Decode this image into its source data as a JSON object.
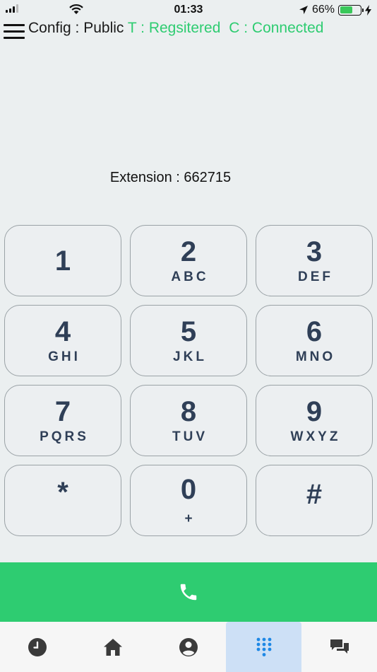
{
  "status_bar": {
    "time": "01:33",
    "battery_percent": "66%",
    "battery_level": 0.66,
    "icons": [
      "signal-icon",
      "wifi-icon",
      "location-arrow-icon",
      "battery-icon",
      "charging-bolt-icon"
    ]
  },
  "header": {
    "config_label": "Config : Public",
    "transport_status": "T : Regsitered",
    "connection_status": "C : Connected",
    "status_color": "#2ecc71"
  },
  "extension_label": "Extension : 662715",
  "keypad": [
    {
      "digit": "1",
      "letters": ""
    },
    {
      "digit": "2",
      "letters": "ABC"
    },
    {
      "digit": "3",
      "letters": "DEF"
    },
    {
      "digit": "4",
      "letters": "GHI"
    },
    {
      "digit": "5",
      "letters": "JKL"
    },
    {
      "digit": "6",
      "letters": "MNO"
    },
    {
      "digit": "7",
      "letters": "PQRS"
    },
    {
      "digit": "8",
      "letters": "TUV"
    },
    {
      "digit": "9",
      "letters": "WXYZ"
    },
    {
      "digit": "*",
      "letters": ""
    },
    {
      "digit": "0",
      "letters": "+"
    },
    {
      "digit": "#",
      "letters": ""
    }
  ],
  "colors": {
    "accent_green": "#2ecc71",
    "key_text": "#2f3f57",
    "active_tab_bg": "#cde0f6",
    "active_tab_icon": "#1e88e5"
  },
  "tabs": [
    {
      "icon": "clock-icon",
      "active": false
    },
    {
      "icon": "home-icon",
      "active": false
    },
    {
      "icon": "user-icon",
      "active": false
    },
    {
      "icon": "dialpad-icon",
      "active": true
    },
    {
      "icon": "chat-icon",
      "active": false
    }
  ]
}
